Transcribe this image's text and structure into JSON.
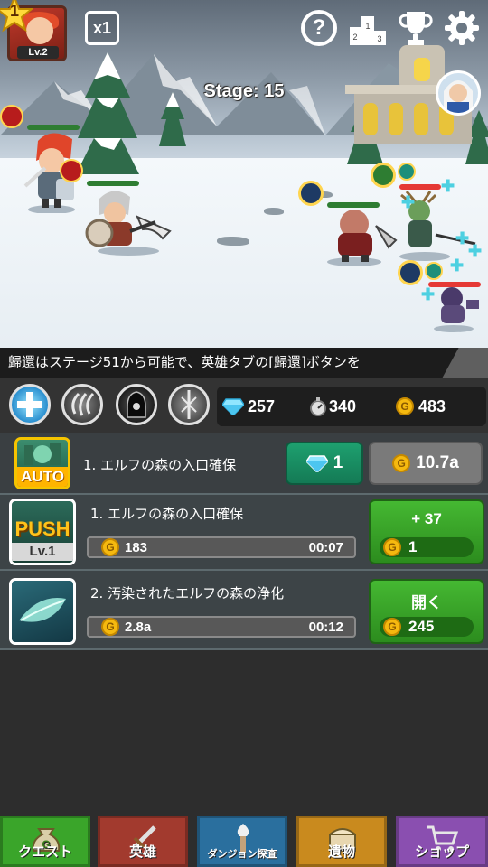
{
  "hud": {
    "hero_level_badge": "1",
    "hero_level": "Lv.2",
    "speed": "x1",
    "help": "?",
    "stage": "Stage: 15"
  },
  "ticker": "歸還はステージ51から可能で、英雄タブの[歸還]ボタンを",
  "currency": {
    "gems": "257",
    "stopwatch": "340",
    "gold": "483"
  },
  "auto_row": {
    "icon_label": "AUTO",
    "title": "1. エルフの森の入口確保",
    "gem_cost": "1",
    "gold_cost": "10.7a"
  },
  "quests": [
    {
      "icon_label": "PUSH",
      "icon_level": "Lv.1",
      "title": "1. エルフの森の入口確保",
      "reward": "183",
      "time": "00:07",
      "button_label": "+ 37",
      "button_cost": "1"
    },
    {
      "title": "2. 汚染されたエルフの森の浄化",
      "reward": "2.8a",
      "time": "00:12",
      "button_label": "開く",
      "button_cost": "245"
    }
  ],
  "nav": [
    {
      "label": "クエスト",
      "color": "#3aa52a",
      "icon": "money-bag-icon"
    },
    {
      "label": "英雄",
      "color": "#a23a2e",
      "icon": "sword-icon"
    },
    {
      "label": "ダンジョン探査",
      "color": "#2a6f9e",
      "icon": "torch-icon"
    },
    {
      "label": "遺物",
      "color": "#c98a1e",
      "icon": "chest-icon"
    },
    {
      "label": "ショップ",
      "color": "#8a4fb0",
      "icon": "cart-icon"
    }
  ]
}
